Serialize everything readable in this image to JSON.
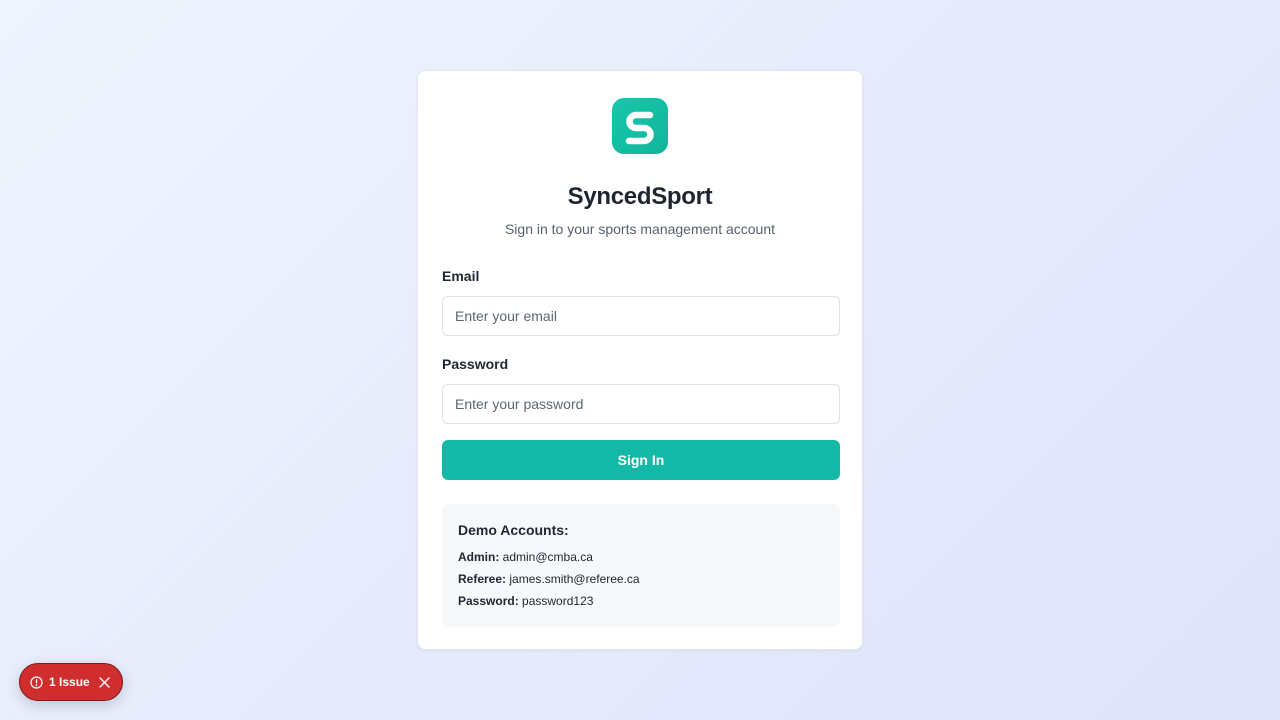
{
  "brand": {
    "name": "SyncedSport",
    "tagline": "Sign in to your sports management account",
    "logo_letter": "S",
    "logo_color": "#14b8a6"
  },
  "form": {
    "email_label": "Email",
    "email_placeholder": "Enter your email",
    "email_value": "",
    "password_label": "Password",
    "password_placeholder": "Enter your password",
    "password_value": "",
    "submit_label": "Sign In"
  },
  "demo": {
    "title": "Demo Accounts:",
    "accounts": [
      {
        "role": "Admin:",
        "value": "admin@cmba.ca"
      },
      {
        "role": "Referee:",
        "value": "james.smith@referee.ca"
      },
      {
        "role": "Password:",
        "value": "password123"
      }
    ]
  },
  "issue_badge": {
    "label": "1 Issue",
    "icon": "alert-circle-icon",
    "close_icon": "close-icon",
    "color": "#d02e2e"
  },
  "colors": {
    "accent": "#14b8a6",
    "text": "#1f2430",
    "muted": "#56606e"
  }
}
